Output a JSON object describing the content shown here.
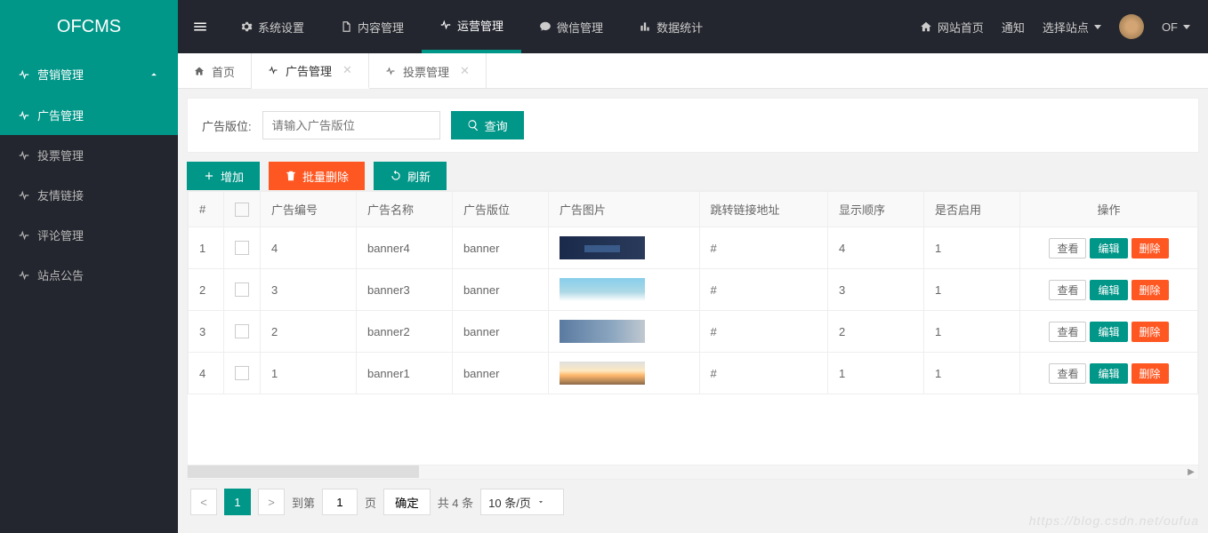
{
  "brand": "OFCMS",
  "topnav": [
    {
      "label": "系统设置",
      "icon": "gear"
    },
    {
      "label": "内容管理",
      "icon": "doc"
    },
    {
      "label": "运营管理",
      "icon": "pulse",
      "active": true
    },
    {
      "label": "微信管理",
      "icon": "chat"
    },
    {
      "label": "数据统计",
      "icon": "bars"
    }
  ],
  "header_links": {
    "site_home": "网站首页",
    "notice": "通知",
    "select_site": "选择站点",
    "user": "OF"
  },
  "sidebar": {
    "group": "营销管理",
    "items": [
      {
        "label": "广告管理",
        "active": true
      },
      {
        "label": "投票管理"
      },
      {
        "label": "友情链接"
      },
      {
        "label": "评论管理"
      },
      {
        "label": "站点公告"
      }
    ]
  },
  "tabs": [
    {
      "label": "首页",
      "icon": "home",
      "closable": false
    },
    {
      "label": "广告管理",
      "icon": "pulse",
      "closable": true,
      "active": true
    },
    {
      "label": "投票管理",
      "icon": "pulse",
      "closable": true
    }
  ],
  "filter": {
    "label": "广告版位:",
    "placeholder": "请输入广告版位",
    "query_btn": "查询"
  },
  "toolbar": {
    "add": "增加",
    "batch_delete": "批量删除",
    "refresh": "刷新"
  },
  "columns": {
    "idx": "#",
    "ad_no": "广告编号",
    "ad_name": "广告名称",
    "ad_slot": "广告版位",
    "ad_img": "广告图片",
    "jump_url": "跳转链接地址",
    "order": "显示顺序",
    "enabled": "是否启用",
    "actions": "操作"
  },
  "rows": [
    {
      "idx": 1,
      "no": "4",
      "name": "banner4",
      "slot": "banner",
      "thumb": "thumb1",
      "url": "#",
      "order": "4",
      "enabled": "1"
    },
    {
      "idx": 2,
      "no": "3",
      "name": "banner3",
      "slot": "banner",
      "thumb": "thumb2",
      "url": "#",
      "order": "3",
      "enabled": "1"
    },
    {
      "idx": 3,
      "no": "2",
      "name": "banner2",
      "slot": "banner",
      "thumb": "thumb3",
      "url": "#",
      "order": "2",
      "enabled": "1"
    },
    {
      "idx": 4,
      "no": "1",
      "name": "banner1",
      "slot": "banner",
      "thumb": "thumb4",
      "url": "#",
      "order": "1",
      "enabled": "1"
    }
  ],
  "row_actions": {
    "view": "查看",
    "edit": "编辑",
    "delete": "删除"
  },
  "pager": {
    "current": "1",
    "goto_label": "到第",
    "goto_value": "1",
    "page_label": "页",
    "confirm": "确定",
    "total": "共 4 条",
    "per_page": "10 条/页"
  },
  "watermark": "https://blog.csdn.net/oufua"
}
